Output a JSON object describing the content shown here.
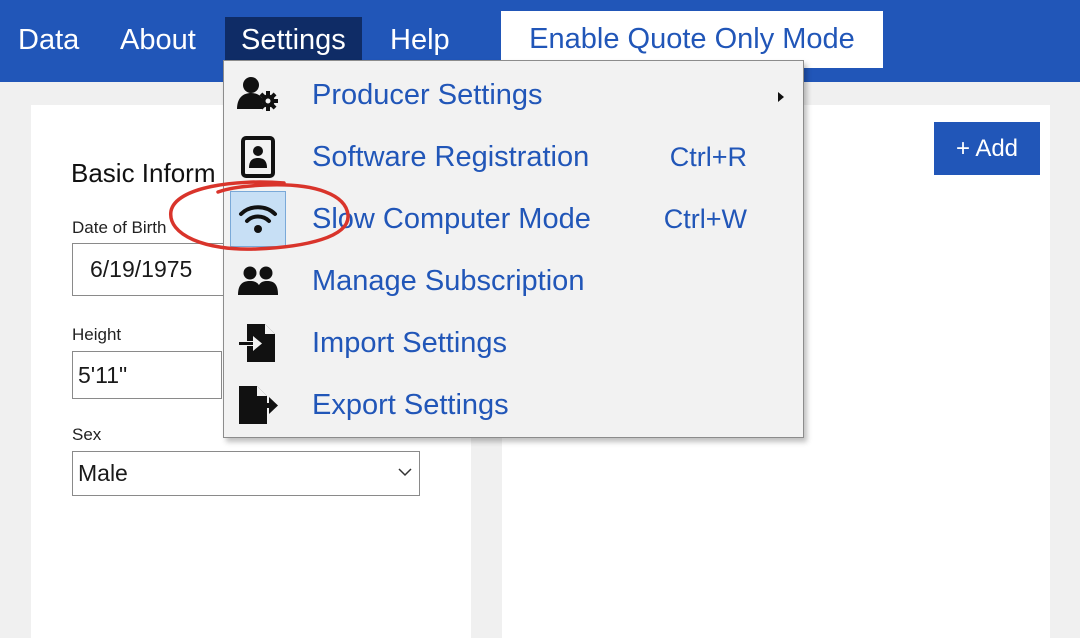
{
  "menubar": {
    "items": [
      {
        "label": "Data"
      },
      {
        "label": "About"
      },
      {
        "label": "Settings"
      },
      {
        "label": "Help"
      }
    ],
    "quote_button": "Enable Quote Only Mode",
    "color": "#2156b8"
  },
  "form": {
    "section_title": "Basic Inform",
    "dob_label": "Date of Birth",
    "dob_value": "6/19/1975",
    "height_label": "Height",
    "height_value": "5'11\"",
    "sex_label": "Sex",
    "sex_value": "Male"
  },
  "right_panel": {
    "add_button": "+ Add"
  },
  "settings_menu": {
    "items": [
      {
        "label": "Producer Settings",
        "shortcut": "",
        "icon": "user-gear-icon",
        "has_submenu": true
      },
      {
        "label": "Software Registration",
        "shortcut": "Ctrl+R",
        "icon": "id-badge-icon"
      },
      {
        "label": "Slow Computer Mode",
        "shortcut": "Ctrl+W",
        "icon": "wifi-icon",
        "highlighted": true
      },
      {
        "label": "Manage Subscription",
        "shortcut": "",
        "icon": "users-icon"
      },
      {
        "label": "Import Settings",
        "shortcut": "",
        "icon": "file-import-icon"
      },
      {
        "label": "Export Settings",
        "shortcut": "",
        "icon": "file-export-icon"
      }
    ]
  },
  "annotation": {
    "shape": "red-circle",
    "color": "#d9342b",
    "target": "wifi-icon"
  }
}
